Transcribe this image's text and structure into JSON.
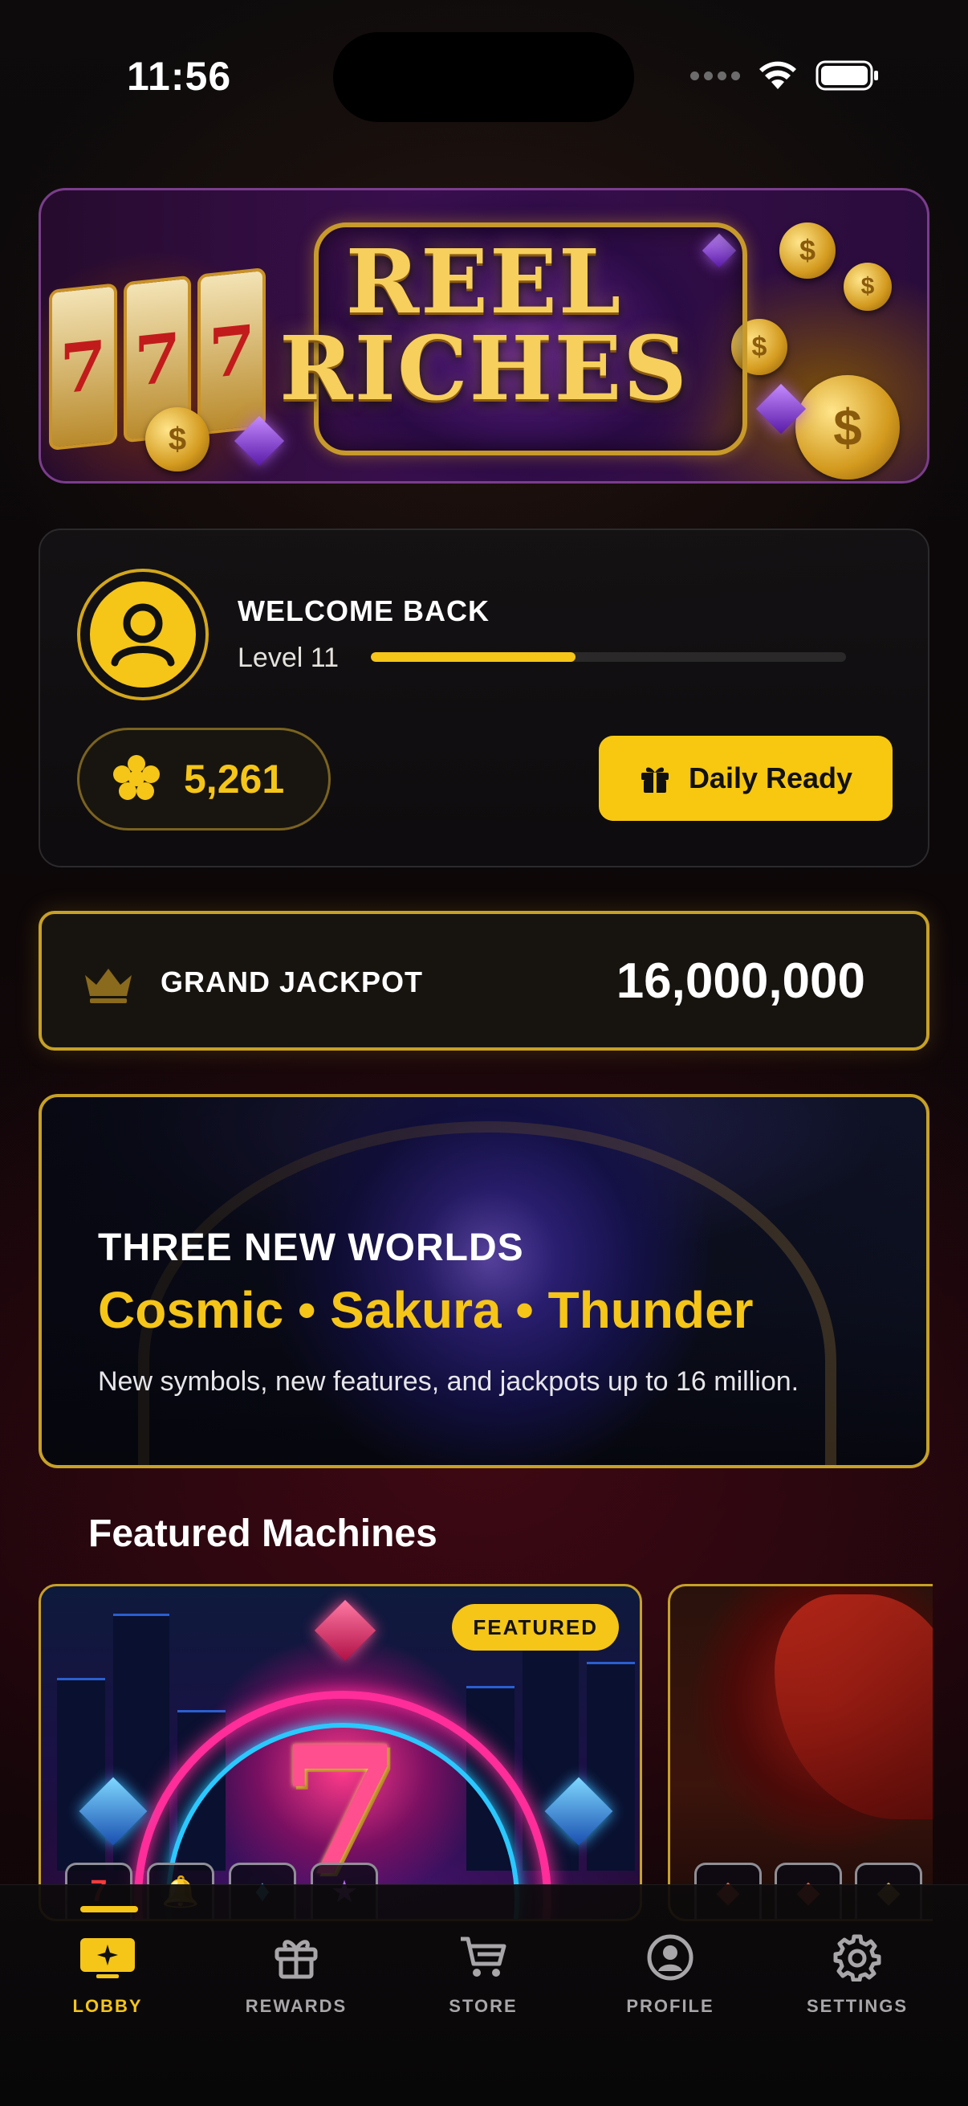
{
  "status_bar": {
    "time": "11:56"
  },
  "hero": {
    "title_line1": "REEL",
    "title_line2": "RICHES",
    "reel_symbols": [
      "7",
      "7",
      "7"
    ]
  },
  "profile": {
    "welcome": "WELCOME BACK",
    "level": "Level 11",
    "level_progress_percent": 43,
    "coins": "5,261",
    "daily_button": "Daily Ready"
  },
  "jackpot": {
    "label": "GRAND JACKPOT",
    "value": "16,000,000"
  },
  "promo": {
    "kicker": "THREE NEW WORLDS",
    "title": "Cosmic • Sakura • Thunder",
    "description": "New symbols, new features, and jackpots up to 16 million."
  },
  "featured": {
    "section_title": "Featured Machines",
    "cards": [
      {
        "badge": "FEATURED",
        "symbol": "7",
        "tiles": [
          "7",
          "🔔",
          "♦",
          "★"
        ]
      },
      {
        "tiles": [
          "◆",
          "◆",
          "◆"
        ]
      }
    ]
  },
  "tab_bar": {
    "active": "lobby",
    "tabs": [
      {
        "id": "lobby",
        "label": "LOBBY",
        "icon": "lobby-icon"
      },
      {
        "id": "rewards",
        "label": "REWARDS",
        "icon": "gift-icon"
      },
      {
        "id": "store",
        "label": "STORE",
        "icon": "cart-icon"
      },
      {
        "id": "profile",
        "label": "PROFILE",
        "icon": "user-icon"
      },
      {
        "id": "settings",
        "label": "SETTINGS",
        "icon": "gear-icon"
      }
    ]
  },
  "colors": {
    "accent": "#f5c518",
    "gold_border": "#c7a125",
    "background": "#0a0708"
  }
}
